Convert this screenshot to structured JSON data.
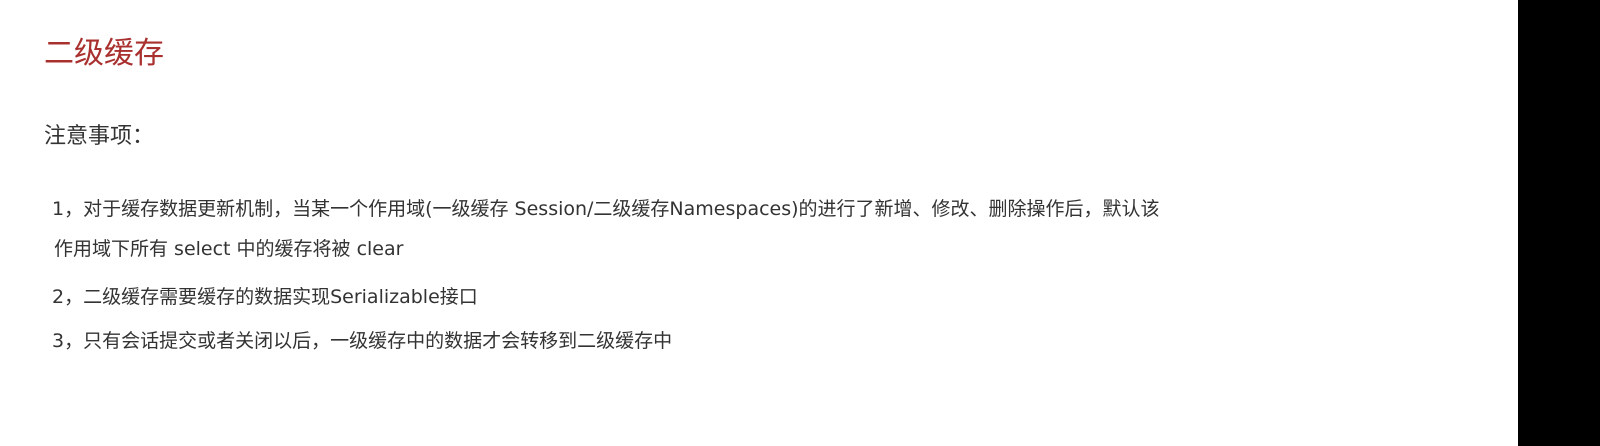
{
  "slide": {
    "title": "二级缓存",
    "subtitle": "注意事项：",
    "items": [
      {
        "line1": "1，对于缓存数据更新机制，当某一个作用域(一级缓存 Session/二级缓存Namespaces)的进行了新增、修改、删除操作后，默认该",
        "line2": "作用域下所有 select 中的缓存将被 clear"
      },
      {
        "line1": "2，二级缓存需要缓存的数据实现Serializable接口"
      },
      {
        "line1": "3，只有会话提交或者关闭以后，一级缓存中的数据才会转移到二级缓存中"
      }
    ]
  },
  "colors": {
    "title": "#a8302e",
    "text": "#333333",
    "background": "#ffffff",
    "side_band": "#000000"
  }
}
